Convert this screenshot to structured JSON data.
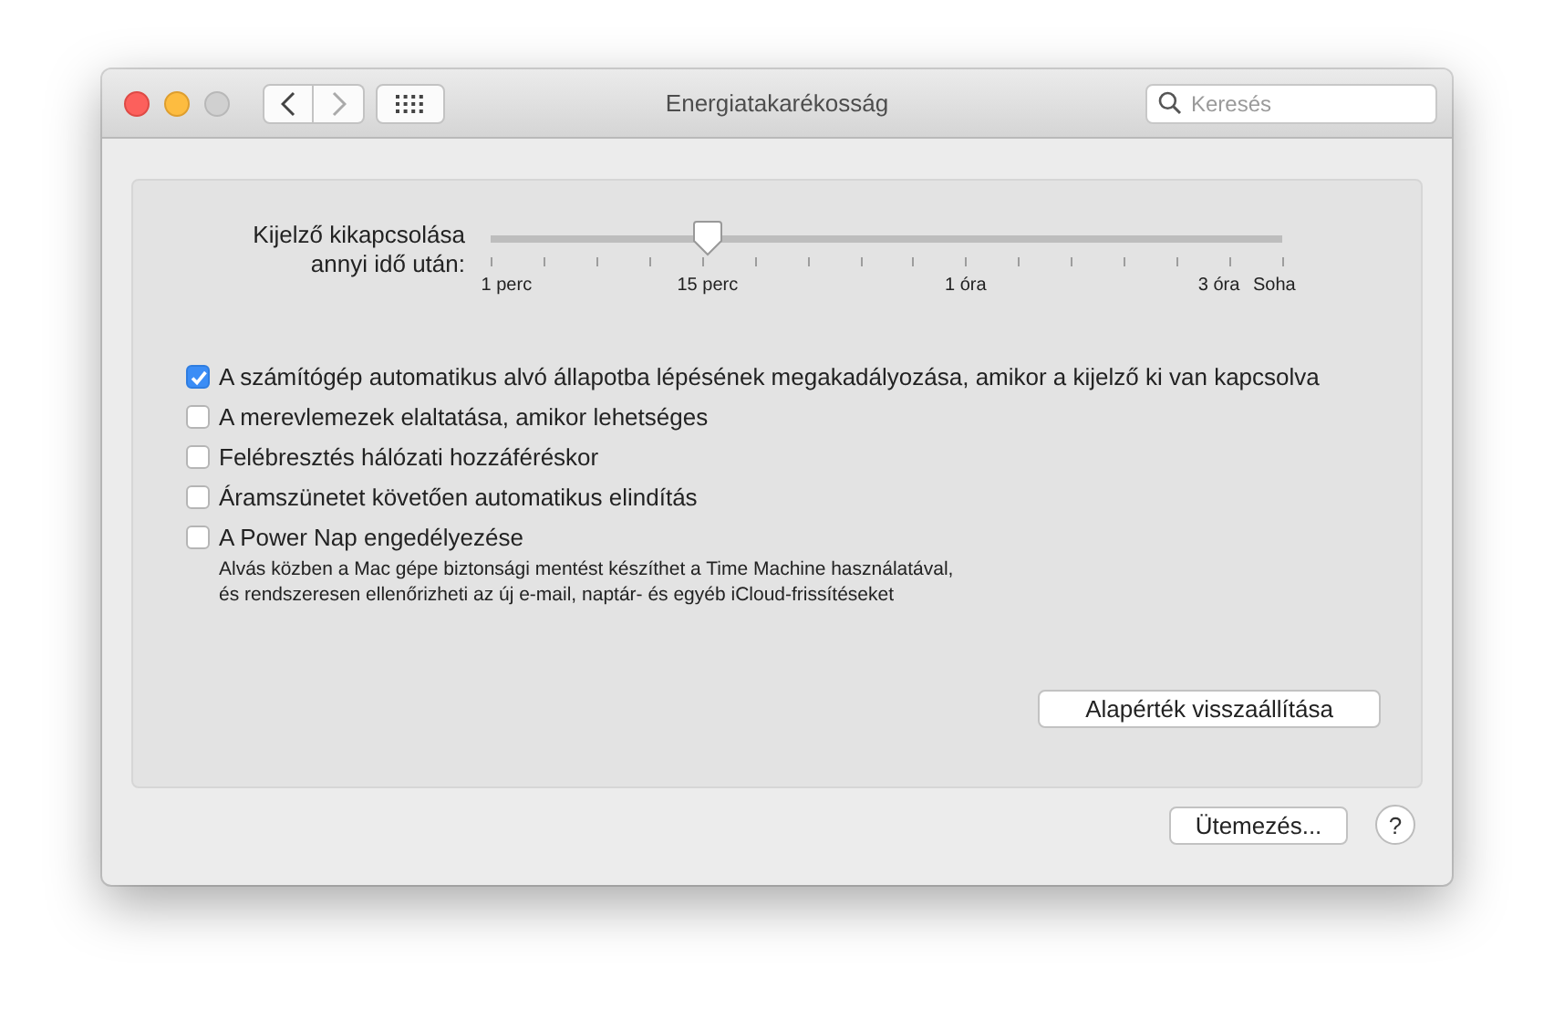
{
  "window": {
    "title": "Energiatakarékosság"
  },
  "search": {
    "placeholder": "Keresés"
  },
  "slider": {
    "label_lines": [
      "Kijelző kikapcsolása",
      "annyi idő után:"
    ],
    "level": 0.274,
    "tick_labels": [
      "1 perc",
      "15 perc",
      "1 óra",
      "3 óra",
      "Soha"
    ]
  },
  "options": [
    {
      "label": "A számítógép automatikus alvó állapotba lépésének megakadályozása, amikor a kijelző ki van kapcsolva",
      "checked": true
    },
    {
      "label": "A merevlemezek elaltatása, amikor lehetséges",
      "checked": false
    },
    {
      "label": "Felébresztés hálózati hozzáféréskor",
      "checked": false
    },
    {
      "label": "Áramszünetet követően automatikus elindítás",
      "checked": false
    },
    {
      "label": "A Power Nap engedélyezése",
      "checked": false,
      "description_lines": [
        "Alvás közben a Mac gépe biztonsági mentést készíthet a Time Machine használatával,",
        "és rendszeresen ellenőrizheti az új e-mail, naptár- és egyéb iCloud-frissítéseket"
      ]
    }
  ],
  "restore_button": "Alapérték visszaállítása",
  "schedule_button": "Ütemezés...",
  "help_button": "?"
}
